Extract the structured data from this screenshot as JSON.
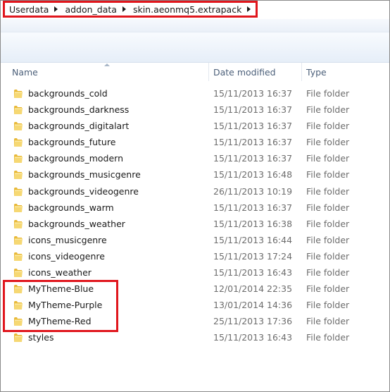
{
  "address": {
    "crumbs": [
      "Userdata",
      "addon_data",
      "skin.aeonmq5.extrapack"
    ]
  },
  "columns": {
    "name": "Name",
    "date_modified": "Date modified",
    "type": "Type"
  },
  "files": [
    {
      "name": "backgrounds_cold",
      "date": "15/11/2013 16:37",
      "type": "File folder"
    },
    {
      "name": "backgrounds_darkness",
      "date": "15/11/2013 16:37",
      "type": "File folder"
    },
    {
      "name": "backgrounds_digitalart",
      "date": "15/11/2013 16:37",
      "type": "File folder"
    },
    {
      "name": "backgrounds_future",
      "date": "15/11/2013 16:37",
      "type": "File folder"
    },
    {
      "name": "backgrounds_modern",
      "date": "15/11/2013 16:37",
      "type": "File folder"
    },
    {
      "name": "backgrounds_musicgenre",
      "date": "15/11/2013 16:48",
      "type": "File folder"
    },
    {
      "name": "backgrounds_videogenre",
      "date": "26/11/2013 10:19",
      "type": "File folder"
    },
    {
      "name": "backgrounds_warm",
      "date": "15/11/2013 16:37",
      "type": "File folder"
    },
    {
      "name": "backgrounds_weather",
      "date": "15/11/2013 16:38",
      "type": "File folder"
    },
    {
      "name": "icons_musicgenre",
      "date": "15/11/2013 16:44",
      "type": "File folder"
    },
    {
      "name": "icons_videogenre",
      "date": "15/11/2013 17:24",
      "type": "File folder"
    },
    {
      "name": "icons_weather",
      "date": "15/11/2013 16:43",
      "type": "File folder"
    },
    {
      "name": "MyTheme-Blue",
      "date": "12/01/2014 22:35",
      "type": "File folder"
    },
    {
      "name": "MyTheme-Purple",
      "date": "13/01/2014 14:36",
      "type": "File folder"
    },
    {
      "name": "MyTheme-Red",
      "date": "25/11/2013 17:36",
      "type": "File folder"
    },
    {
      "name": "styles",
      "date": "15/11/2013 16:43",
      "type": "File folder"
    }
  ],
  "colors": {
    "annotation_red": "#e0161d",
    "folder_yellow": "#f3cf5a",
    "header_text": "#4c607a"
  },
  "icons": {
    "folder": "folder-icon",
    "breadcrumb_separator": "chevron-right-icon",
    "sort": "sort-ascending-icon"
  }
}
